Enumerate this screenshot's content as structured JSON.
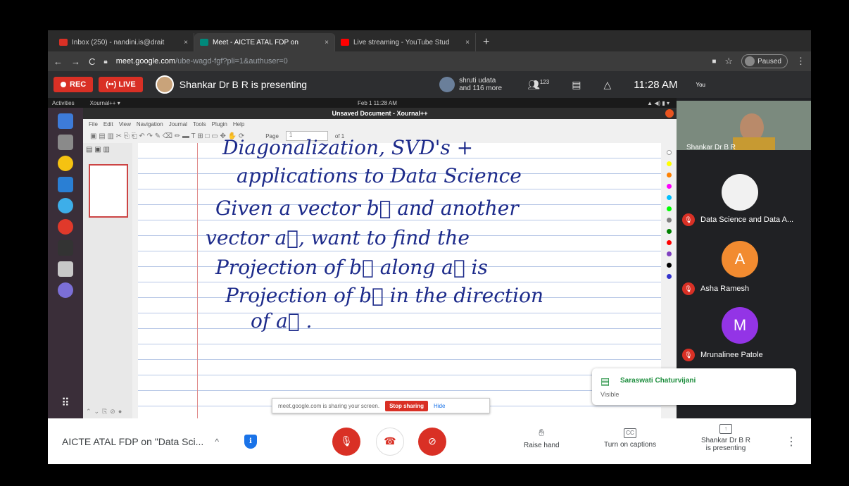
{
  "tabs": [
    {
      "label": "Inbox (250) - nandini.is@drait",
      "color": "#d93025"
    },
    {
      "label": "Meet - AICTE ATAL FDP on",
      "color": "#00897b"
    },
    {
      "label": "Live streaming - YouTube Stud",
      "color": "#ff0000"
    }
  ],
  "address": {
    "url_main": "meet.google.com",
    "url_rest": "/ube-wagd-fgf?pli=1&authuser=0",
    "profile": "Paused"
  },
  "meetbar": {
    "rec": "REC",
    "live": "(••) LIVE",
    "presenting": "Shankar Dr B R is presenting",
    "people_line1": "shruti udata",
    "people_line2": "and 116 more",
    "people_count": "123",
    "time": "11:28 AM",
    "you": "You"
  },
  "shared": {
    "gnome_left": "Activities",
    "gnome_app": "Xournal++ ▾",
    "gnome_time": "Feb 1  11:28 AM",
    "window_title": "Unsaved Document - Xournal++",
    "menu": [
      "File",
      "Edit",
      "View",
      "Navigation",
      "Journal",
      "Tools",
      "Plugin",
      "Help"
    ],
    "page_label": "Page",
    "page_num": "1",
    "page_of": "of 1",
    "handwriting": [
      "Diagonalization, SVD's +",
      "applications to Data Science",
      "Given a vector b⃗ and another",
      "vector a⃗,   want to find the",
      "Projection of b⃗ along a⃗ is",
      "Projection of b⃗ in the direction",
      "of a⃗ ."
    ],
    "palette": [
      "#ffffff",
      "#ffff00",
      "#ff8000",
      "#ff00ff",
      "#00c0ff",
      "#00ff00",
      "#808080",
      "#008000",
      "#ff0000",
      "#8040c0",
      "#000000",
      "#3333cc"
    ]
  },
  "sharebar": {
    "text": "meet.google.com is sharing your screen.",
    "stop": "Stop sharing",
    "hide": "Hide"
  },
  "participants": [
    {
      "name": "Shankar Dr B R"
    },
    {
      "name": "Data Science and Data A..."
    },
    {
      "name": "Asha Ramesh",
      "initial": "A",
      "color": "#f28b30"
    },
    {
      "name": "Mrunalinee Patole",
      "initial": "M",
      "color": "#9334e6"
    }
  ],
  "notification": {
    "who": "Saraswati Chaturvijani",
    "text": "Visible"
  },
  "bottom": {
    "meeting_title": "AICTE ATAL FDP on \"Data Sci...",
    "raise_hand": "Raise hand",
    "captions": "Turn on captions",
    "presenting_line1": "Shankar Dr B R",
    "presenting_line2": "is presenting"
  }
}
